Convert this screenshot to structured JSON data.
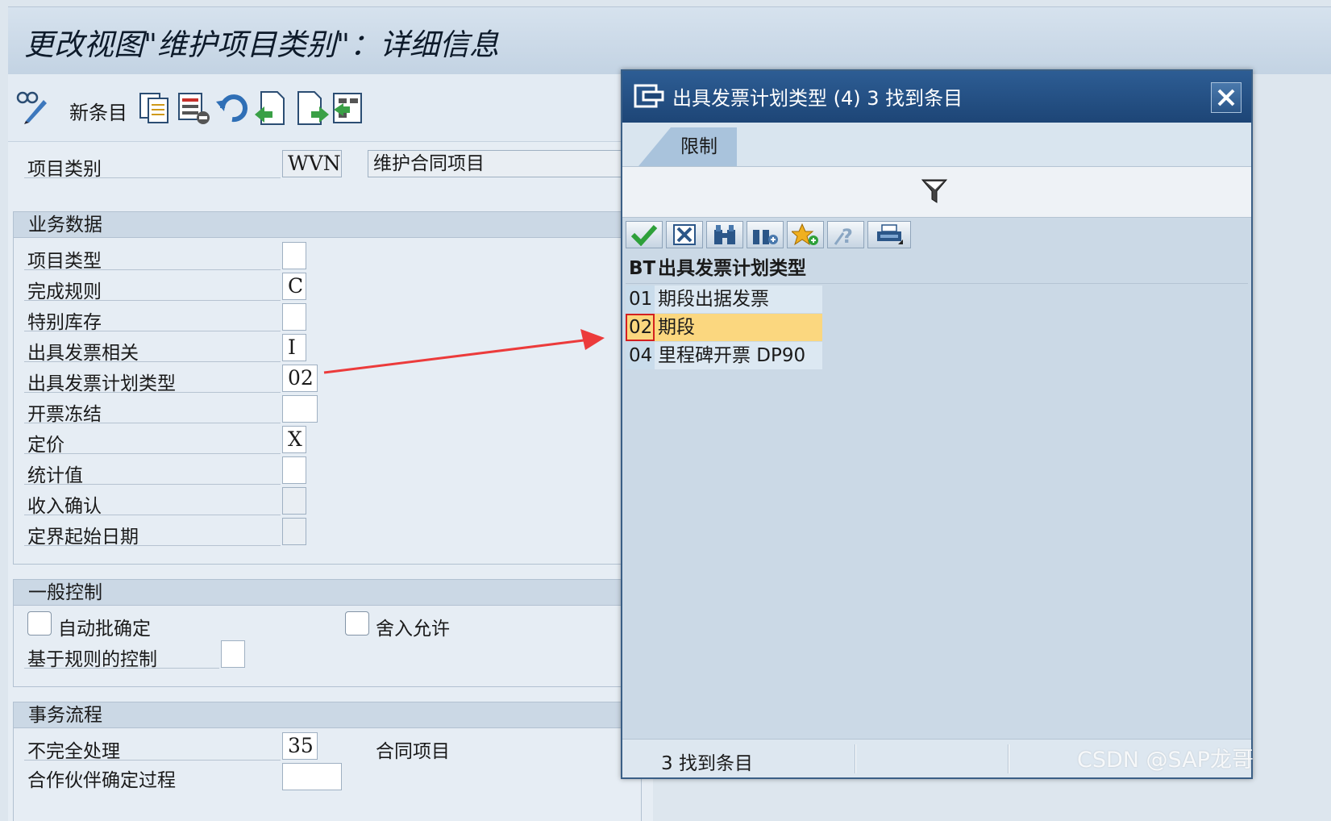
{
  "window": {
    "title": "更改视图\"维护项目类别\"：详细信息"
  },
  "toolbar": {
    "new_entries_label": "新条目"
  },
  "header_fields": {
    "item_category_label": "项目类别",
    "item_category_value": "WVN",
    "item_category_desc": "维护合同项目"
  },
  "business_data": {
    "title": "业务数据",
    "rows": [
      {
        "label": "项目类型",
        "value": ""
      },
      {
        "label": "完成规则",
        "value": "C"
      },
      {
        "label": "特别库存",
        "value": ""
      },
      {
        "label": "出具发票相关",
        "value": "I"
      },
      {
        "label": "出具发票计划类型",
        "value": "02"
      },
      {
        "label": "开票冻结",
        "value": ""
      },
      {
        "label": "定价",
        "value": "X"
      },
      {
        "label": "统计值",
        "value": ""
      },
      {
        "label": "收入确认",
        "value": ""
      },
      {
        "label": "定界起始日期",
        "value": ""
      }
    ]
  },
  "general_control": {
    "title": "一般控制",
    "auto_batch_label": "自动批确定",
    "rounding_label": "舍入允许",
    "rule_based_label": "基于规则的控制"
  },
  "transaction_flow": {
    "title": "事务流程",
    "incompletion_label": "不完全处理",
    "incompletion_value": "35",
    "incompletion_desc": "合同项目",
    "partner_label": "合作伙伴确定过程",
    "partner_value": ""
  },
  "dialog": {
    "title": "出具发票计划类型 (4)    3 找到条目",
    "tab_label": "限制",
    "col_key": "BT",
    "col_text": "出具发票计划类型",
    "rows": [
      {
        "key": "01",
        "text": "期段出据发票"
      },
      {
        "key": "02",
        "text": "期段"
      },
      {
        "key": "04",
        "text": "里程碑开票 DP90"
      }
    ],
    "status_text": "3 找到条目"
  },
  "watermark": "CSDN @SAP龙哥"
}
